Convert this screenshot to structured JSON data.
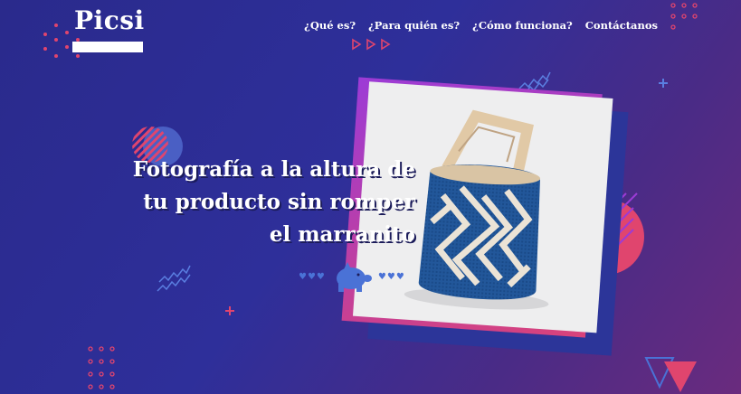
{
  "brand": {
    "logo_text": "Picsi"
  },
  "nav": {
    "items": [
      {
        "label": "¿Qué es?"
      },
      {
        "label": "¿Para quién es?"
      },
      {
        "label": "¿Cómo funciona?"
      },
      {
        "label": "Contáctanos"
      }
    ]
  },
  "hero": {
    "title_lines": [
      "Fotografía a la altura de",
      "tu producto sin romper",
      "el marranito"
    ]
  },
  "decor": {
    "hearts_left": "♥♥♥",
    "hearts_right": "♥♥♥",
    "icons": [
      "piggy-bank-icon",
      "play-arrows-icon",
      "plus-icon",
      "triangle-icon",
      "dot-grid-icon",
      "zigzag-icon"
    ]
  },
  "colors": {
    "bg_start": "#2a2a8c",
    "bg_end": "#6a2b7e",
    "accent_pink": "#e0456e",
    "accent_purple": "#9c3bd6",
    "accent_blue": "#4a72d6"
  }
}
